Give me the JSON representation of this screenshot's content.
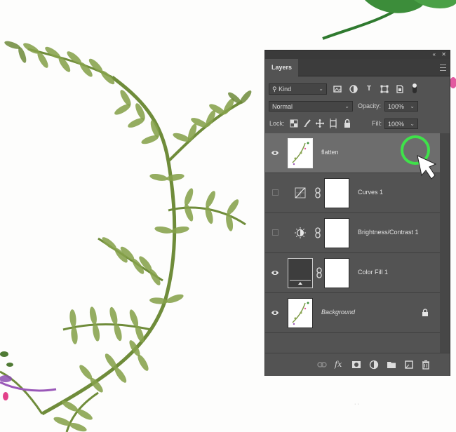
{
  "panel": {
    "title": "Layers",
    "filter": {
      "label": "Kind"
    },
    "blend_mode": "Normal",
    "opacity": {
      "label": "Opacity:",
      "value": "100%"
    },
    "lock": {
      "label": "Lock:"
    },
    "fill": {
      "label": "Fill:",
      "value": "100%"
    },
    "layers": [
      {
        "name": "flatten",
        "visible": true,
        "selected": true,
        "type": "pixel"
      },
      {
        "name": "Curves 1",
        "visible": false,
        "type": "curves"
      },
      {
        "name": "Brightness/Contrast 1",
        "visible": false,
        "type": "brightness"
      },
      {
        "name": "Color Fill 1",
        "visible": true,
        "type": "fill"
      },
      {
        "name": "Background",
        "visible": true,
        "locked": true,
        "type": "background"
      }
    ]
  },
  "colors": {
    "panel_bg": "#535353",
    "selected_row": "#6d6d6d",
    "highlight_ring": "#3fe24a",
    "fern": "#7d9a45"
  }
}
